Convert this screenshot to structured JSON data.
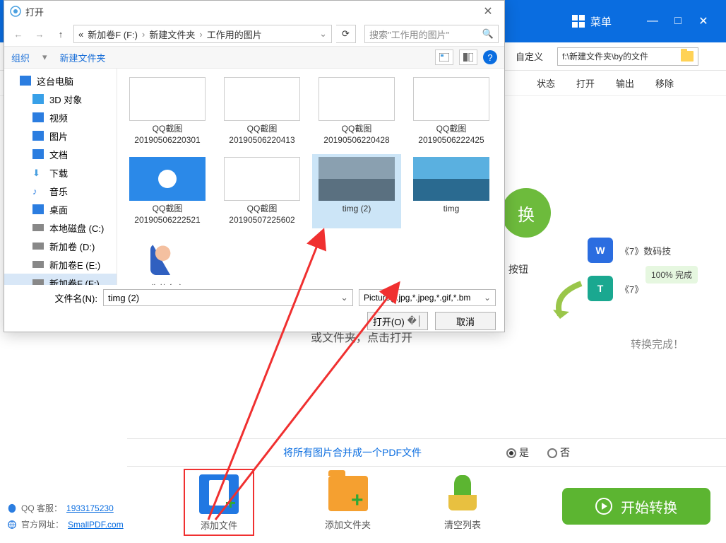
{
  "bgApp": {
    "menuLabel": "菜单",
    "customLabel": "自定义",
    "pathValue": "f:\\新建文件夹\\by的文件",
    "headers": {
      "status": "状态",
      "open": "打开",
      "output": "输出",
      "remove": "移除"
    },
    "convertBtn": "换",
    "centerLine1": "或文件夹，点击打开",
    "clickBtnText": "按钮",
    "rightItems": [
      {
        "label": "《7》数码技",
        "icon": "W",
        "color": "#2b6de0"
      },
      {
        "label": "《7》",
        "icon": "T",
        "color": "#1aa890"
      }
    ],
    "checkText": "100% 完成",
    "doneText": "转换完成！",
    "mergeLabel": "将所有图片合并成一个PDF文件",
    "yes": "是",
    "no": "否",
    "actions": {
      "addFile": "添加文件",
      "addFolder": "添加文件夹",
      "clear": "清空列表"
    },
    "startBtn": "开始转换",
    "footer": {
      "qqLabel": "QQ 客服：",
      "qqNum": "1933175230",
      "siteLabel": "官方网址：",
      "siteUrl": "SmallPDF.com"
    }
  },
  "dlg": {
    "title": "打开",
    "crumbs": [
      "新加卷F (F:)",
      "新建文件夹",
      "工作用的图片"
    ],
    "crumbPrefix": "«",
    "searchPlaceholder": "搜索\"工作用的图片\"",
    "toolbar": {
      "organize": "组织",
      "newFolder": "新建文件夹"
    },
    "tree": [
      {
        "label": "这台电脑",
        "icon": "pc"
      },
      {
        "label": "3D 对象",
        "icon": "d3",
        "sub": true
      },
      {
        "label": "视频",
        "icon": "vid",
        "sub": true
      },
      {
        "label": "图片",
        "icon": "img",
        "sub": true
      },
      {
        "label": "文档",
        "icon": "doc",
        "sub": true
      },
      {
        "label": "下载",
        "icon": "dl",
        "sub": true
      },
      {
        "label": "音乐",
        "icon": "music",
        "sub": true
      },
      {
        "label": "桌面",
        "icon": "desk",
        "sub": true
      },
      {
        "label": "本地磁盘 (C:)",
        "icon": "drive",
        "sub": true
      },
      {
        "label": "新加卷 (D:)",
        "icon": "drive",
        "sub": true
      },
      {
        "label": "新加卷E (E:)",
        "icon": "drive",
        "sub": true
      },
      {
        "label": "新加卷F (F:)",
        "icon": "drive",
        "sub": true,
        "sel": true
      }
    ],
    "files": [
      {
        "label": "QQ截图20190506220301",
        "thumb": "doc"
      },
      {
        "label": "QQ截图20190506220413",
        "thumb": "doc"
      },
      {
        "label": "QQ截图20190506220428",
        "thumb": "doc"
      },
      {
        "label": "QQ截图20190506222425",
        "thumb": "doc"
      },
      {
        "label": "QQ截图20190506222521",
        "thumb": "blue"
      },
      {
        "label": "QQ截图20190507225602",
        "thumb": "doc"
      },
      {
        "label": "timg (2)",
        "thumb": "photo",
        "sel": true
      },
      {
        "label": "timg",
        "thumb": "lake"
      },
      {
        "label": "你的名字",
        "thumb": "anime"
      }
    ],
    "fileNameLabel": "文件名(N):",
    "fileNameValue": "timg (2)",
    "filterValue": "Picture(*.jpg,*.jpeg,*.gif,*.bm",
    "openBtn": "打开(O)",
    "cancelBtn": "取消"
  }
}
